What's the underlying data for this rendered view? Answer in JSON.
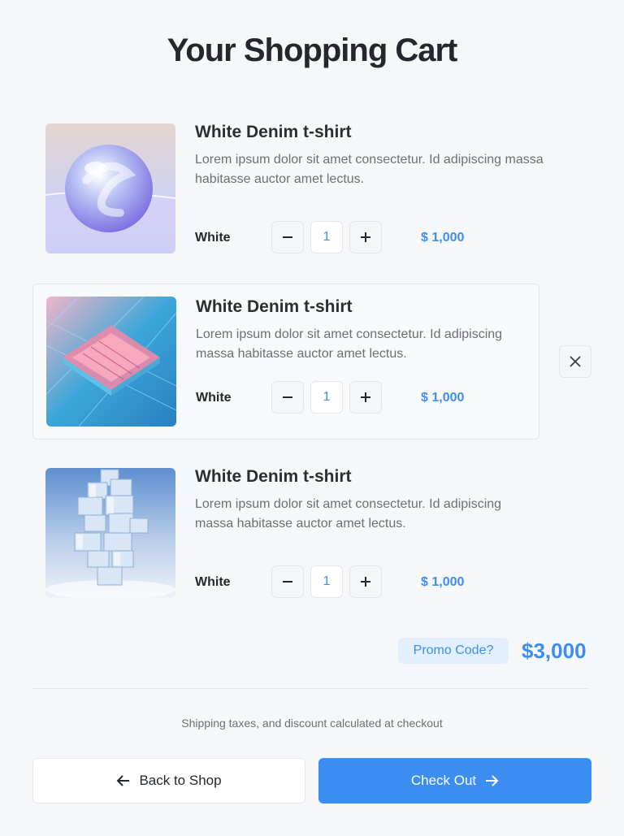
{
  "page": {
    "title": "Your Shopping Cart"
  },
  "items": [
    {
      "name": "White Denim t-shirt",
      "description": "Lorem ipsum dolor sit amet consectetur. Id adipiscing massa habitasse auctor amet lectus.",
      "variant": "White",
      "quantity": "1",
      "price": "$ 1,000"
    },
    {
      "name": "White Denim t-shirt",
      "description": "Lorem ipsum dolor sit amet consectetur. Id adipiscing massa habitasse auctor amet lectus.",
      "variant": "White",
      "quantity": "1",
      "price": "$ 1,000"
    },
    {
      "name": "White Denim t-shirt",
      "description": "Lorem ipsum dolor sit amet consectetur. Id adipiscing massa habitasse auctor amet lectus.",
      "variant": "White",
      "quantity": "1",
      "price": "$ 1,000"
    }
  ],
  "summary": {
    "promo_label": "Promo Code?",
    "total": "$3,000",
    "note": "Shipping taxes, and discount calculated at checkout"
  },
  "actions": {
    "back_label": "Back to Shop",
    "checkout_label": "Check Out"
  },
  "colors": {
    "accent": "#3b8ef0",
    "background": "#f6f7f9",
    "promo_bg": "#e3effc"
  },
  "icons": [
    "minus-icon",
    "plus-icon",
    "close-icon",
    "arrow-left-icon",
    "arrow-right-icon"
  ]
}
